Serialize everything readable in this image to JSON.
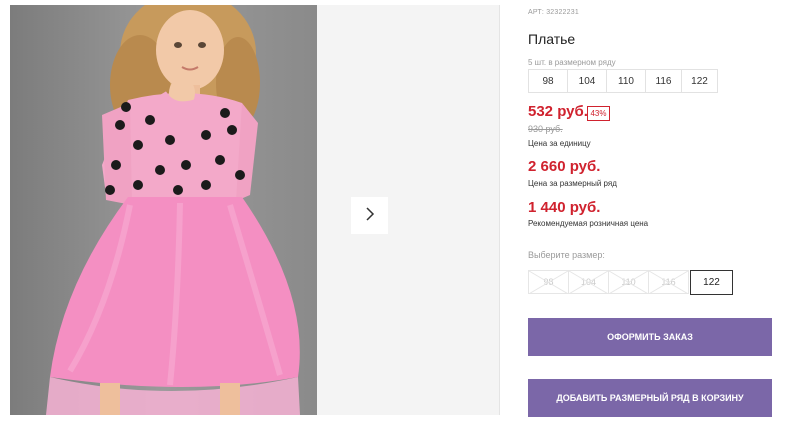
{
  "product": {
    "sku": "АРТ: 32322231",
    "title": "Платье",
    "pack_note": "5 шт. в размерном ряду"
  },
  "pack_sizes": [
    "98",
    "104",
    "110",
    "116",
    "122"
  ],
  "prices": {
    "unit_price": "532 руб.",
    "discount_badge": "43%",
    "old_price": "930 руб.",
    "unit_caption": "Цена за единицу",
    "pack_price": "2 660 руб.",
    "pack_caption": "Цена за размерный ряд",
    "retail_price": "1 440 руб.",
    "retail_caption": "Рекомендуемая розничная цена"
  },
  "size_select": {
    "label": "Выберите размер:",
    "options": [
      {
        "label": "98",
        "available": false
      },
      {
        "label": "104",
        "available": false
      },
      {
        "label": "110",
        "available": false
      },
      {
        "label": "116",
        "available": false
      },
      {
        "label": "122",
        "available": true,
        "selected": true
      }
    ]
  },
  "actions": {
    "order_label": "Оформить заказ",
    "add_to_cart_label": "Добавить размерный ряд в корзину"
  },
  "colors": {
    "price_red": "#d0222e",
    "button_purple": "#7b67a8"
  },
  "icons": {
    "gallery_next": "chevron-right-icon"
  }
}
